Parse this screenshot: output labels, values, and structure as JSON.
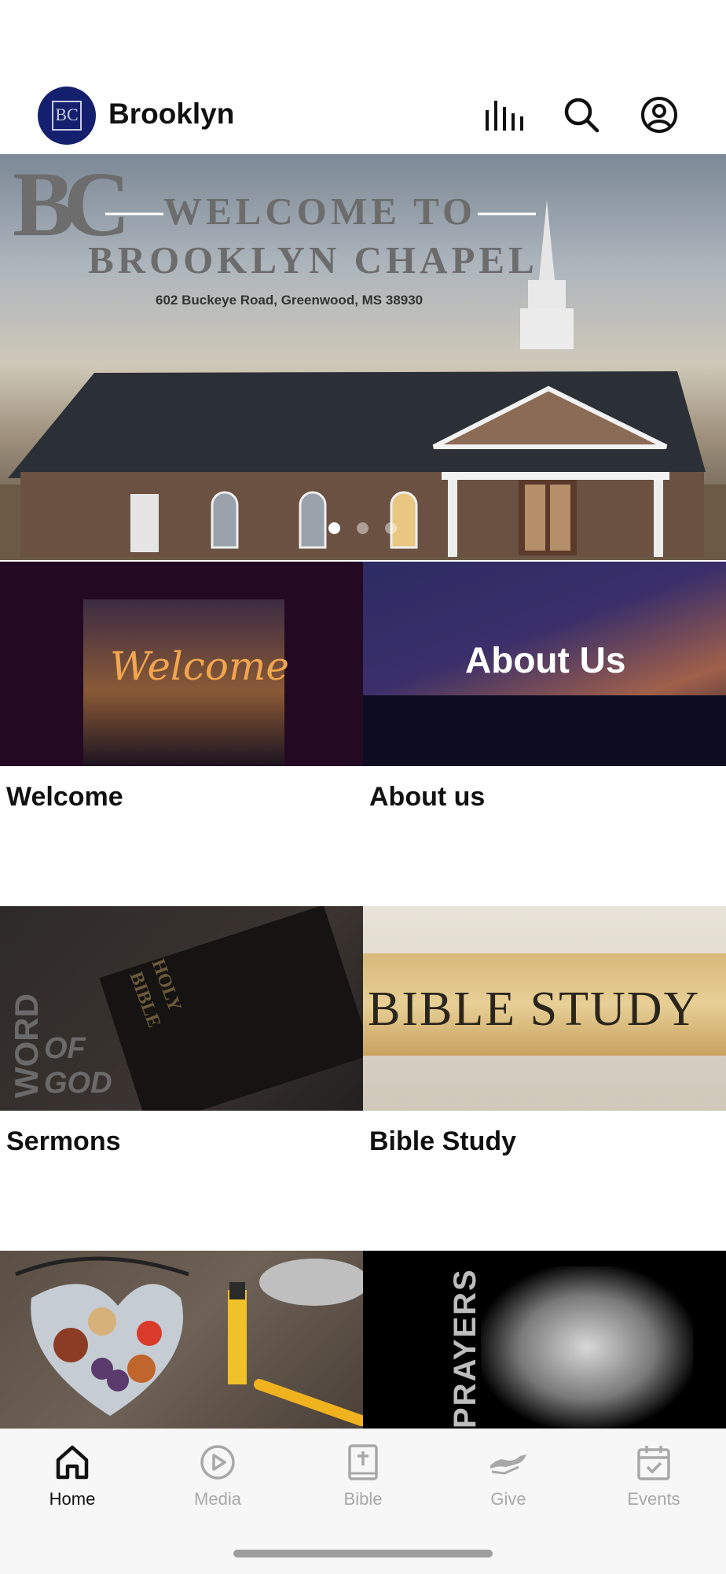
{
  "header": {
    "title": "Brooklyn",
    "logo_text": "BC",
    "icons": [
      "equalizer-icon",
      "search-icon",
      "profile-icon"
    ]
  },
  "carousel": {
    "line1": "WELCOME TO",
    "line2": "BROOKLYN CHAPEL",
    "logo_letters": "BC",
    "address": "602 Buckeye Road, Greenwood, MS 38930",
    "slide_count": 3,
    "active_index": 0
  },
  "tiles": [
    {
      "label": "Welcome",
      "image_text": "Welcome"
    },
    {
      "label": "About us",
      "image_text": "About Us"
    },
    {
      "label": "Sermons",
      "image_text_1": "WORD",
      "image_text_2": "OF",
      "image_text_3": "GOD",
      "book_text_1": "HOLY",
      "book_text_2": "BIBLE"
    },
    {
      "label": "Bible Study",
      "image_text": "BIBLE STUDY"
    },
    {
      "label": "",
      "image_text": ""
    },
    {
      "label": "",
      "image_text": "PRAYERS"
    }
  ],
  "tabbar": {
    "items": [
      {
        "label": "Home",
        "icon": "home-icon",
        "active": true
      },
      {
        "label": "Media",
        "icon": "play-icon",
        "active": false
      },
      {
        "label": "Bible",
        "icon": "bible-icon",
        "active": false
      },
      {
        "label": "Give",
        "icon": "give-icon",
        "active": false
      },
      {
        "label": "Events",
        "icon": "calendar-icon",
        "active": false
      }
    ]
  },
  "colors": {
    "brand": "#14206e",
    "tab_active": "#111111",
    "tab_inactive": "#a8a8a8"
  }
}
